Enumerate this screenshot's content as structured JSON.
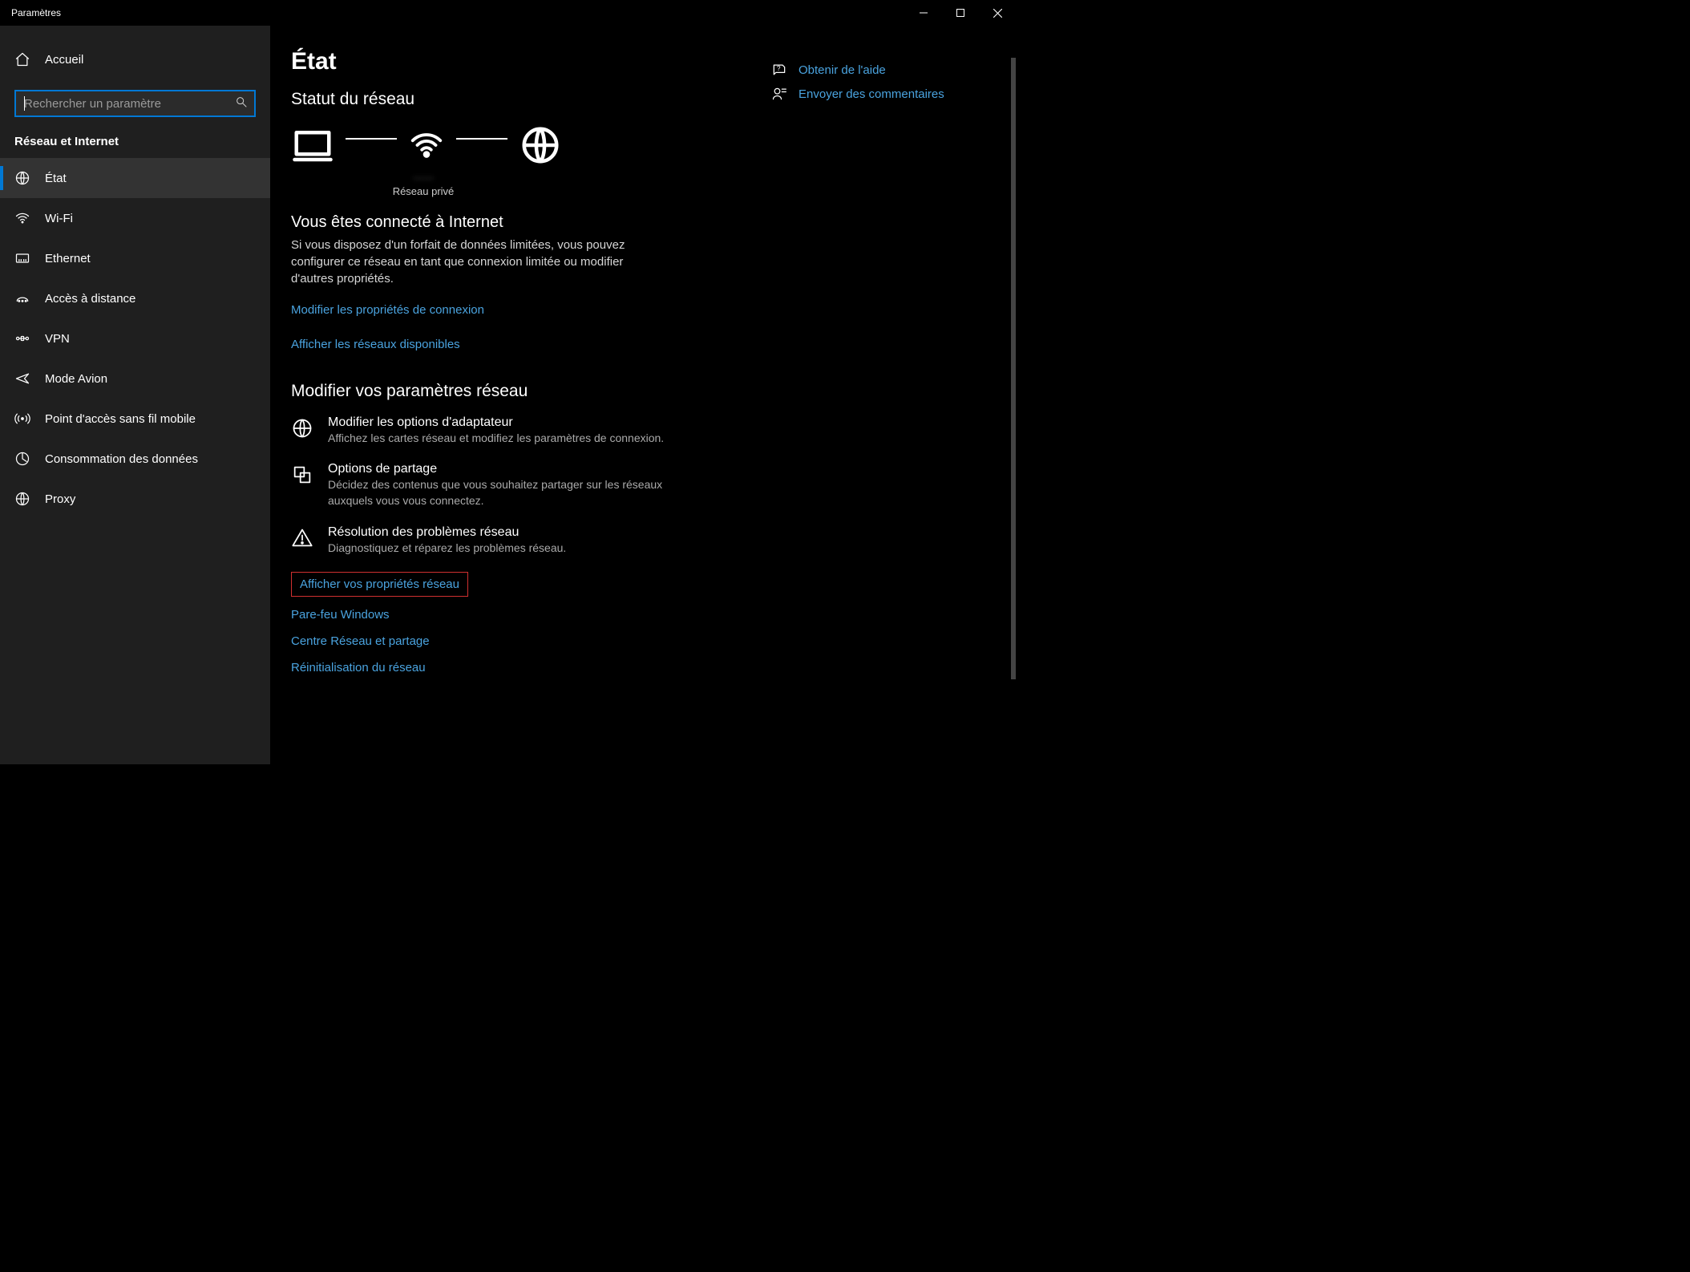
{
  "window": {
    "title": "Paramètres"
  },
  "sidebar": {
    "home": "Accueil",
    "search_placeholder": "Rechercher un paramètre",
    "category": "Réseau et Internet",
    "items": [
      {
        "label": "État"
      },
      {
        "label": "Wi-Fi"
      },
      {
        "label": "Ethernet"
      },
      {
        "label": "Accès à distance"
      },
      {
        "label": "VPN"
      },
      {
        "label": "Mode Avion"
      },
      {
        "label": "Point d'accès sans fil mobile"
      },
      {
        "label": "Consommation des données"
      },
      {
        "label": "Proxy"
      }
    ]
  },
  "main": {
    "title": "État",
    "status_heading": "Statut du réseau",
    "network": {
      "ssid": "······",
      "profile": "Réseau privé"
    },
    "connected_title": "Vous êtes connecté à Internet",
    "connected_desc": "Si vous disposez d'un forfait de données limitées, vous pouvez configurer ce réseau en tant que connexion limitée ou modifier d'autres propriétés.",
    "link_modify_props": "Modifier les propriétés de connexion",
    "link_show_networks": "Afficher les réseaux disponibles",
    "modify_heading": "Modifier vos paramètres réseau",
    "options": [
      {
        "title": "Modifier les options d'adaptateur",
        "desc": "Affichez les cartes réseau et modifiez les paramètres de connexion."
      },
      {
        "title": "Options de partage",
        "desc": "Décidez des contenus que vous souhaitez partager sur les réseaux auxquels vous vous connectez."
      },
      {
        "title": "Résolution des problèmes réseau",
        "desc": "Diagnostiquez et réparez les problèmes réseau."
      }
    ],
    "link_view_props": "Afficher vos propriétés réseau",
    "link_firewall": "Pare-feu Windows",
    "link_center": "Centre Réseau et partage",
    "link_reset": "Réinitialisation du réseau"
  },
  "help": {
    "get_help": "Obtenir de l'aide",
    "feedback": "Envoyer des commentaires"
  }
}
